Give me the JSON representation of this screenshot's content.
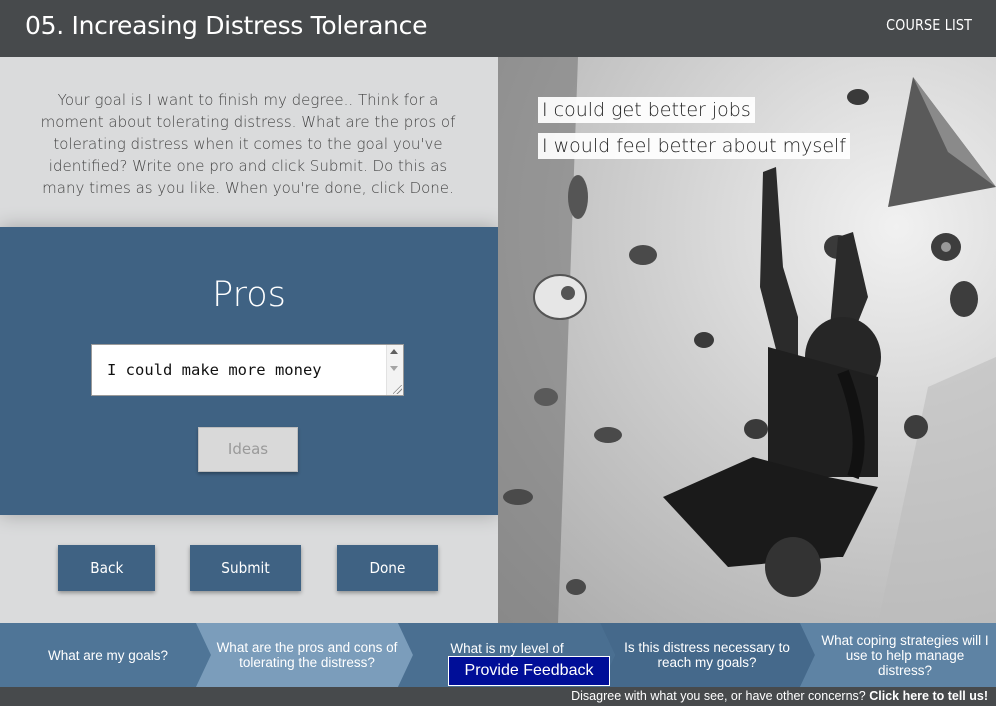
{
  "header": {
    "title": "05. Increasing Distress Tolerance",
    "course_list": "COURSE LIST"
  },
  "instructions": "Your goal is I want to finish my degree.. Think for a moment about tolerating distress. What are the pros of tolerating distress when it comes to the goal you've identified? Write one pro and click Submit. Do this as many times as you like. When you're done, click Done.",
  "panel": {
    "title": "Pros",
    "input_value": "I could make more money",
    "ideas_label": "Ideas"
  },
  "buttons": {
    "back": "Back",
    "submit": "Submit",
    "done": "Done"
  },
  "pros_list": [
    "I could get better jobs",
    "I would feel better about myself"
  ],
  "steps": [
    "What are my goals?",
    "What are the pros and cons of tolerating the distress?",
    "What is my level of",
    "Is this distress necessary to reach my goals?",
    "What coping strategies will I use to help manage distress?"
  ],
  "feedback_button": "Provide Feedback",
  "footer": {
    "text": "Disagree with what you see, or have other concerns?",
    "link": "Click here to tell us!"
  },
  "colors": {
    "header_bg": "#474a4c",
    "panel_bg": "#3f6283",
    "steps_bg": "#5e83a4",
    "active_step": "#7b9dbb",
    "feedback_bg": "#000e98"
  }
}
